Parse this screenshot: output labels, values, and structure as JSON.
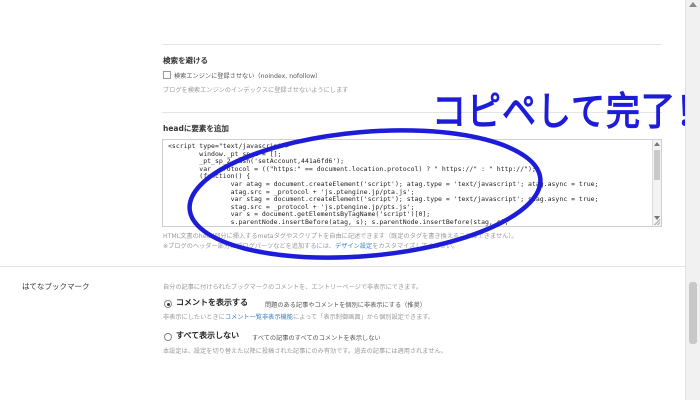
{
  "search_block": {
    "heading": "検索を避ける",
    "checkbox_label": "検索エンジンに登録させない（noindex, nofollow）",
    "hint": "ブログを検索エンジンのインデックスに登録させないようにします"
  },
  "head_block": {
    "heading": "headに要素を追加",
    "code": "<script type=\"text/javascript\">\n        window._pt_sp_2 = [];\n        _pt_sp_2.push('setAccount,441a6fd6');\n        var _protocol = ((\"https:\" == document.location.protocol) ? \" https://\" : \" http://\");\n        (function() {\n                var atag = document.createElement('script'); atag.type = 'text/javascript'; atag.async = true;\n                atag.src = _protocol + 'js.ptengine.jp/pta.js';\n                var stag = document.createElement('script'); stag.type = 'text/javascript'; stag.async = true;\n                stag.src = _protocol + 'js.ptengine.jp/pts.js';\n                var s = document.getElementsByTagName('script')[0];\n                s.parentNode.insertBefore(atag, s); s.parentNode.insertBefore(stag, s);",
    "note1": "HTML文書のhead部分に挿入するmetaタグやスクリプトを自由に記述できます（既定のタグを書き換えることはできません）。",
    "note2_prefix": "※ブログのヘッダー部分にブログパーツなどを追加するには、",
    "note2_link": "デザイン設定",
    "note2_suffix": "をカスタマイズしてください。"
  },
  "annotation": {
    "text": "コピペして完了！",
    "color": "#1c1cd9"
  },
  "hatena_block": {
    "label": "はてなブックマーク",
    "description": "自分の記事に付けられたブックマークのコメントを、エントリーページで非表示にできます。",
    "option1": {
      "label": "コメントを表示する",
      "desc": "問題のある記事やコメントを個別に非表示にする（推奨）",
      "checked": true,
      "sub_prefix": "非表示にしたいときに",
      "sub_link": "コメント一覧非表示機能",
      "sub_suffix": "によって「表示制御画面」から個別設定できます。"
    },
    "option2": {
      "label": "すべて表示しない",
      "desc": "すべての記事のすべてのコメントを表示しない",
      "checked": false
    },
    "footer": "本設定は、設定を切り替えた以降に投稿された記事にのみ有効です。過去の記事には適用されません。"
  },
  "colors": {
    "link": "#3b7fc4",
    "annotation": "#1c1cd9"
  }
}
